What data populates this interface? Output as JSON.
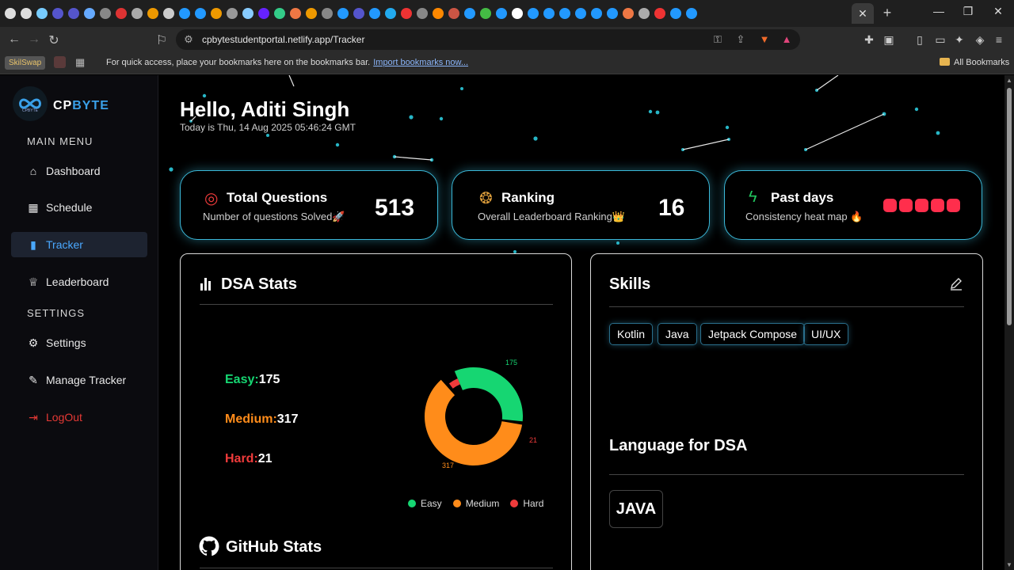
{
  "browser": {
    "url": "cpbytestudentportal.netlify.app/Tracker",
    "bookmarks_hint": "For quick access, place your bookmarks here on the bookmarks bar.",
    "import_link": "Import bookmarks now...",
    "all_bookmarks": "All Bookmarks",
    "skillswap_label": "SkilSwap",
    "favicon_colors": [
      "#ddd",
      "#ddd",
      "#7cf",
      "#55c",
      "#55c",
      "#6af",
      "#888",
      "#d33",
      "#aaa",
      "#e90",
      "#ccc",
      "#29f",
      "#29f",
      "#e90",
      "#999",
      "#8cf",
      "#62f",
      "#3c8",
      "#e74",
      "#e90",
      "#888",
      "#29f",
      "#55c",
      "#29f",
      "#2ae",
      "#e33",
      "#888",
      "#f80",
      "#c54",
      "#29f",
      "#4b4",
      "#29f",
      "#fff",
      "#29f",
      "#29f",
      "#29f",
      "#29f",
      "#29f",
      "#29f",
      "#e74",
      "#aaa",
      "#e33",
      "#29f",
      "#29f"
    ]
  },
  "sidebar": {
    "brand_cp": "CP",
    "brand_byte": "BYTE",
    "logo_sub": "CPBYTE",
    "main_menu_label": "MAIN MENU",
    "settings_label": "SETTINGS",
    "items": [
      {
        "label": "Dashboard",
        "icon": "home-icon"
      },
      {
        "label": "Schedule",
        "icon": "calendar-icon"
      },
      {
        "label": "Tracker",
        "icon": "bar-chart-icon"
      },
      {
        "label": "Leaderboard",
        "icon": "trophy-icon"
      },
      {
        "label": "Settings",
        "icon": "gear-icon"
      },
      {
        "label": "Manage Tracker",
        "icon": "wrench-icon"
      },
      {
        "label": "LogOut",
        "icon": "logout-icon"
      }
    ],
    "active_item": "Tracker"
  },
  "header": {
    "greeting": "Hello, Aditi Singh",
    "today": "Today is Thu, 14 Aug 2025 05:46:24 GMT"
  },
  "cards": {
    "total": {
      "title": "Total Questions",
      "subtitle": "Number of questions Solved🚀",
      "value": "513"
    },
    "ranking": {
      "title": "Ranking",
      "subtitle": "Overall Leaderboard Ranking👑",
      "value": "16"
    },
    "past_days": {
      "title": "Past days",
      "subtitle": "Consistency heat map 🔥",
      "heat_days": 5,
      "heat_color": "#ff2e4c"
    }
  },
  "dsa": {
    "title": "DSA Stats",
    "easy_label": "Easy:",
    "medium_label": "Medium:",
    "hard_label": "Hard:",
    "github_title": "GitHub Stats"
  },
  "chart_data": {
    "type": "pie",
    "variant": "donut",
    "categories": [
      "Easy",
      "Medium",
      "Hard"
    ],
    "values": [
      175,
      317,
      21
    ],
    "value_labels": [
      "175",
      "317",
      "21"
    ],
    "colors": [
      "#16d672",
      "#ff8c1a",
      "#ef3b3b"
    ],
    "legend": "bottom"
  },
  "skills": {
    "title": "Skills",
    "chips": [
      "Kotlin",
      "Java",
      "Jetpack Compose",
      "UI/UX"
    ],
    "language_title": "Language for DSA",
    "language": "JAVA"
  },
  "colors": {
    "accent": "#3aa0e8",
    "card_border": "#3bb8d8",
    "logout": "#e53935"
  }
}
